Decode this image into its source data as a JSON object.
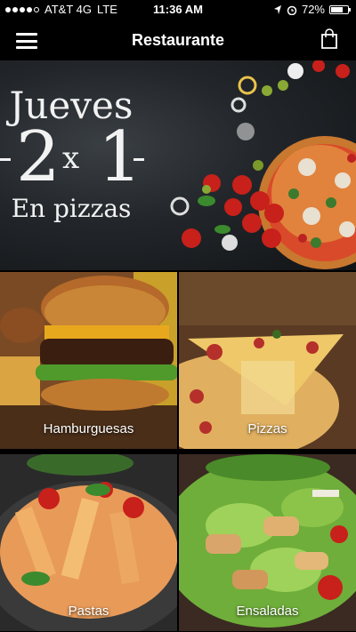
{
  "status_bar": {
    "carrier": "AT&T 4G",
    "network": "LTE",
    "time": "11:36 AM",
    "battery": "72%",
    "battery_level": 0.72
  },
  "nav": {
    "title": "Restaurante",
    "menu_icon": "hamburger-menu-icon",
    "cart_icon": "shopping-bag-icon"
  },
  "banner": {
    "day": "Jueves",
    "promo_left": "2",
    "promo_x": "x",
    "promo_right": "1",
    "subtitle": "En pizzas"
  },
  "categories": [
    {
      "label": "Hamburguesas"
    },
    {
      "label": "Pizzas"
    },
    {
      "label": "Pastas"
    },
    {
      "label": "Ensaladas"
    }
  ]
}
